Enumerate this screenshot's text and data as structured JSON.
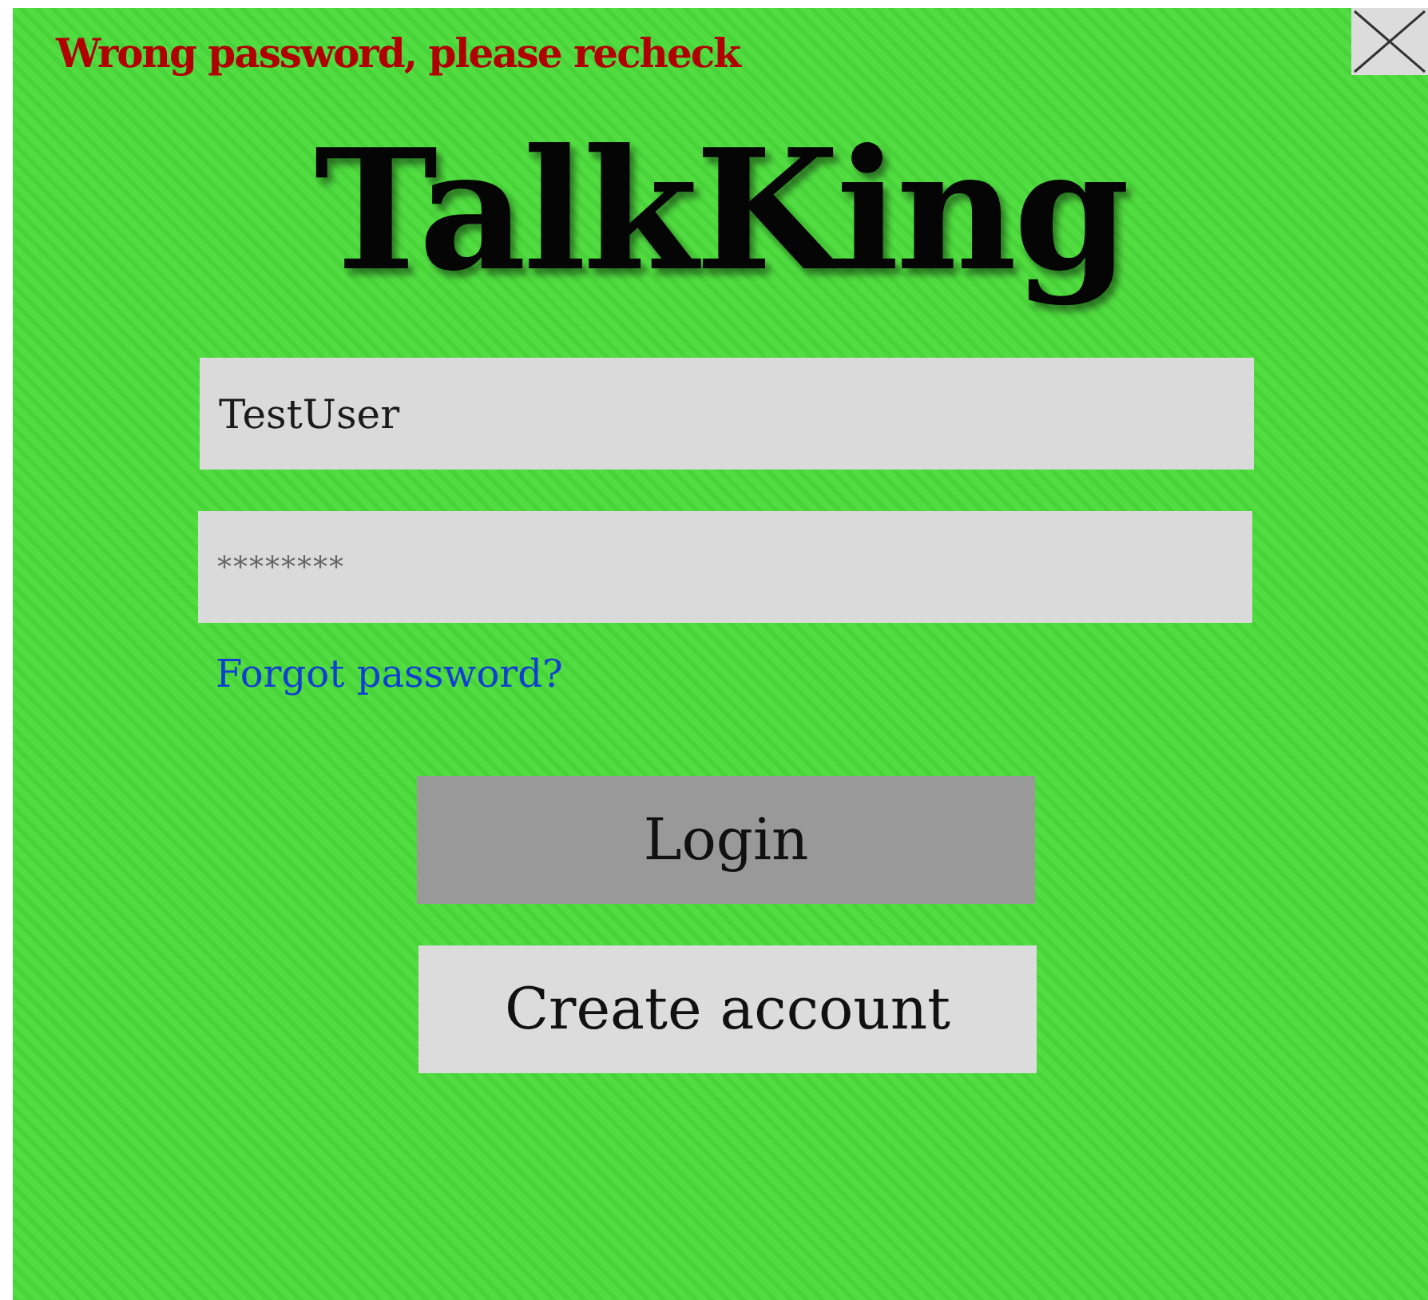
{
  "error_message": "Wrong password, please recheck",
  "close_button": {
    "kind": "close"
  },
  "title": "TalkKing",
  "fields": [
    {
      "kind": "text",
      "value": "TestUser"
    },
    {
      "kind": "password",
      "value": "********"
    }
  ],
  "forgot_link": "Forgot password?",
  "buttons": [
    {
      "label": "Login",
      "kind": "primary"
    },
    {
      "label": "Create account",
      "kind": "secondary"
    }
  ]
}
